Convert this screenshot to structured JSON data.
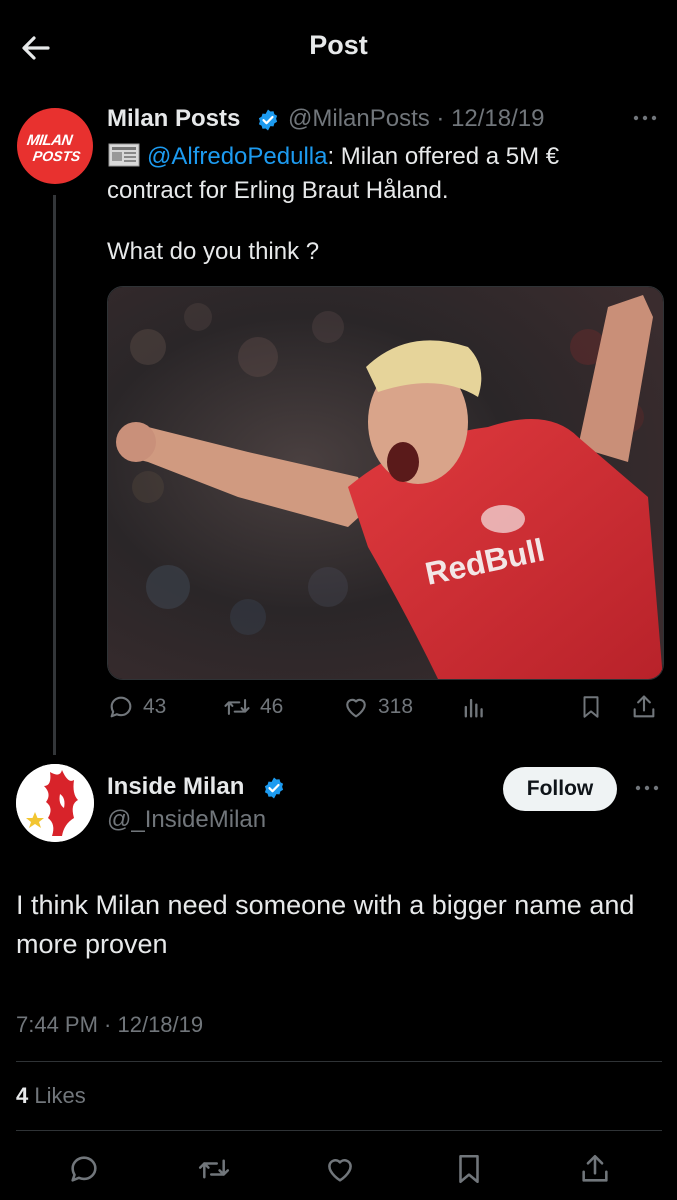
{
  "header": {
    "title": "Post"
  },
  "quoted_post": {
    "avatar_text_line1": "MILAN",
    "avatar_text_line2": "POSTS",
    "display_name": "Milan Posts",
    "handle_date": "@MilanPosts · 12/18/19",
    "mention": "@AlfredoPedulla",
    "text": ": Milan offered a 5M € contract for Erling Braut Håland.",
    "question": "What do you think ?",
    "stats": {
      "replies": "43",
      "reposts": "46",
      "likes": "318"
    }
  },
  "reply_post": {
    "display_name": "Inside Milan",
    "handle": "@_InsideMilan",
    "follow_label": "Follow",
    "text": "I think Milan need someone with a bigger name and more proven",
    "timestamp": "7:44 PM · 12/18/19",
    "likes_count": "4",
    "likes_label": "Likes"
  },
  "colors": {
    "accent": "#1d9bf0",
    "muted": "#71767b",
    "background": "#000000",
    "avatar_red": "#e8312f"
  },
  "icons": [
    "back-arrow-icon",
    "verified-icon",
    "more-icon",
    "reply-icon",
    "repost-icon",
    "like-icon",
    "views-icon",
    "bookmark-icon",
    "share-icon"
  ]
}
